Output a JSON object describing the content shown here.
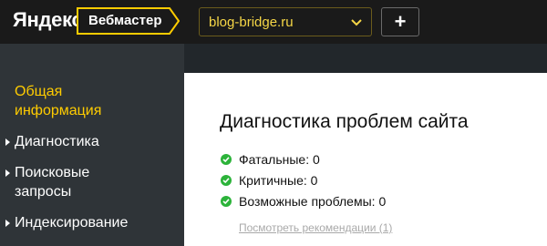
{
  "header": {
    "brand": "Яндекс",
    "product": "Вебмастер",
    "site_selector": {
      "value": "blog-bridge.ru"
    },
    "add_button_label": "+"
  },
  "sidebar": {
    "items": [
      {
        "label": "Общая информация",
        "active": true
      },
      {
        "label": "Диагностика",
        "active": false
      },
      {
        "label": "Поисковые запросы",
        "active": false
      },
      {
        "label": "Индексирование",
        "active": false
      }
    ]
  },
  "main": {
    "title": "Диагностика проблем сайта",
    "stats": [
      {
        "label": "Фатальные: 0"
      },
      {
        "label": "Критичные: 0"
      },
      {
        "label": "Возможные проблемы: 0"
      }
    ],
    "recommendations_link": "Посмотреть рекомендации (1)"
  },
  "colors": {
    "accent": "#ffcc00",
    "success": "#2cb33a",
    "sidebar_bg": "#2f3438",
    "header_bg": "#1a1a1a"
  }
}
